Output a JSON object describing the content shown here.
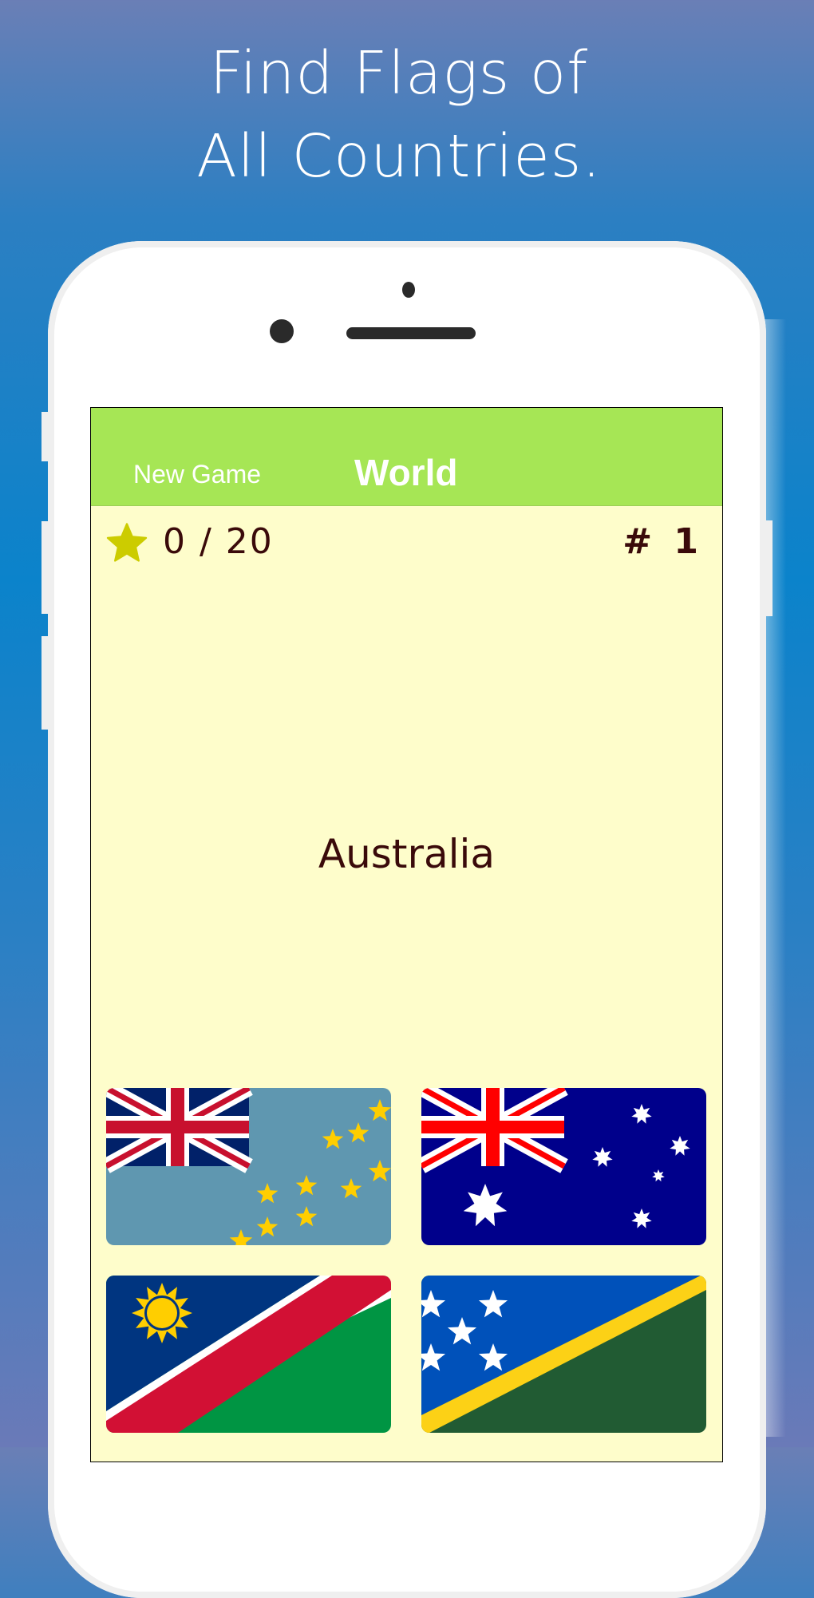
{
  "headline": {
    "line1": "Find Flags of",
    "line2": "All Countries."
  },
  "app": {
    "nav": {
      "new_game_label": "New Game",
      "title": "World"
    },
    "score": {
      "icon": "star-icon",
      "text": "0 / 20",
      "correct": 0,
      "total": 20
    },
    "question_number": "# 1",
    "target_country": "Australia",
    "options": [
      {
        "country": "Tuvalu",
        "icon": "flag-tuvalu-icon"
      },
      {
        "country": "Australia",
        "icon": "flag-australia-icon"
      },
      {
        "country": "Namibia",
        "icon": "flag-namibia-icon"
      },
      {
        "country": "Solomon Islands",
        "icon": "flag-solomon-islands-icon"
      }
    ],
    "colors": {
      "nav_bg": "#a6e655",
      "content_bg": "#fefdcb",
      "text": "#3a0a0a",
      "star": "#cccc00"
    }
  }
}
